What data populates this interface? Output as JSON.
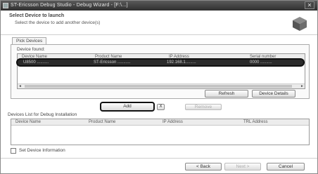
{
  "window": {
    "title": "ST-Ericsson Debug Studio - Debug Wizard - [F:\\...]",
    "close_label": "✕"
  },
  "header": {
    "title": "Select Device to launch",
    "subtitle": "Select the device to add another device(s)",
    "logo_icon": "cube-icon"
  },
  "tab": {
    "label": "Pick Devices"
  },
  "found_panel": {
    "label": "Device found:",
    "columns": [
      "Device Name",
      "Product Name",
      "IP Address",
      "Serial number"
    ],
    "selected_row": [
      "U8500 ..........",
      "ST-Ericsson ...........",
      "192.168.1.........",
      "0000 .........."
    ],
    "scroll_left": "◄",
    "scroll_right": "►",
    "buttons": {
      "refresh": "Refresh",
      "details": "Device Details"
    }
  },
  "actions": {
    "add_label": "Add",
    "remove_icon": "Ⅹ",
    "remove_label": "Remove"
  },
  "selected_panel": {
    "label": "Devices List for Debug Installation",
    "columns": [
      "Device Name",
      "Product Name",
      "IP Address",
      "TRL Address"
    ]
  },
  "checkbox": {
    "label": "Set Device Information",
    "checked": false
  },
  "footer": {
    "back": "< Back",
    "next": "Next >",
    "cancel": "Cancel"
  }
}
